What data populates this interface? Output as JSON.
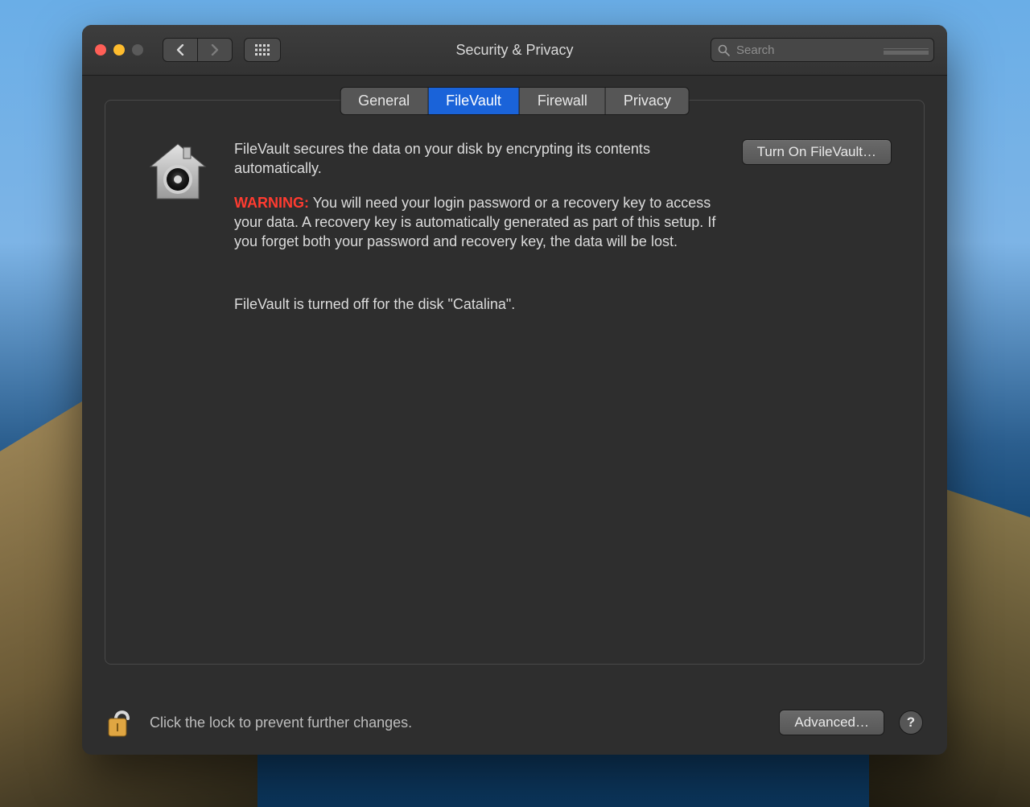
{
  "window": {
    "title": "Security & Privacy"
  },
  "search": {
    "placeholder": "Search"
  },
  "tabs": [
    {
      "label": "General"
    },
    {
      "label": "FileVault"
    },
    {
      "label": "Firewall"
    },
    {
      "label": "Privacy"
    }
  ],
  "active_tab": "FileVault",
  "content": {
    "description": "FileVault secures the data on your disk by encrypting its contents automatically.",
    "warning_label": "WARNING:",
    "warning_text": " You will need your login password or a recovery key to access your data. A recovery key is automatically generated as part of this setup. If you forget both your password and recovery key, the data will be lost.",
    "turn_on_label": "Turn On FileVault…",
    "status": "FileVault is turned off for the disk \"Catalina\"."
  },
  "footer": {
    "lock_text": "Click the lock to prevent further changes.",
    "advanced_label": "Advanced…",
    "help_label": "?"
  }
}
